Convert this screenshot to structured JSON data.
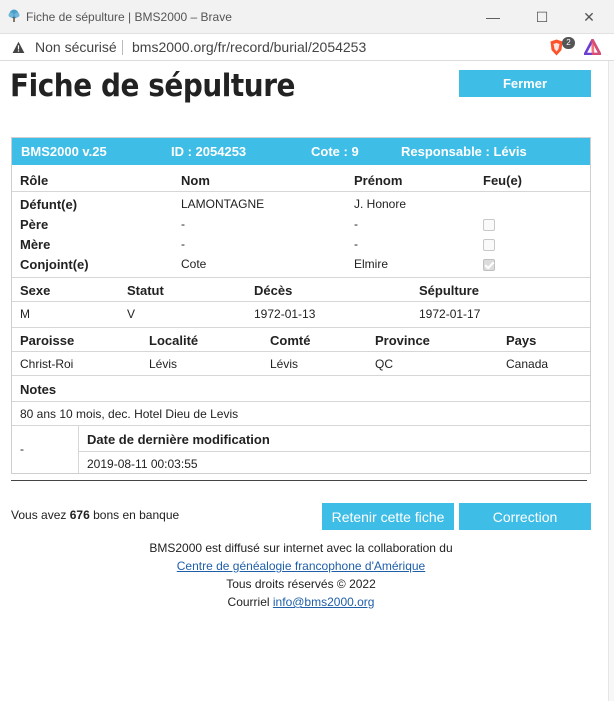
{
  "window": {
    "title": "Fiche de sépulture | BMS2000 – Brave",
    "controls": {
      "minimize": "—",
      "maximize": "☐",
      "close": "✕"
    }
  },
  "addressbar": {
    "security_label": "Non sécurisé",
    "url": "bms2000.org/fr/record/burial/2054253",
    "brave_badge": "2"
  },
  "page": {
    "title": "Fiche de sépulture",
    "close_button": "Fermer"
  },
  "record_header": {
    "version": "BMS2000 v.25",
    "id": "ID : 2054253",
    "cote": "Cote : 9",
    "responsable": "Responsable : Lévis"
  },
  "persons": {
    "headers": {
      "role": "Rôle",
      "nom": "Nom",
      "prenom": "Prénom",
      "feu": "Feu(e)"
    },
    "rows": [
      {
        "role": "Défunt(e)",
        "nom": "LAMONTAGNE",
        "prenom": "J. Honore",
        "feu": null
      },
      {
        "role": "Père",
        "nom": "-",
        "prenom": "-",
        "feu": false
      },
      {
        "role": "Mère",
        "nom": "-",
        "prenom": "-",
        "feu": false
      },
      {
        "role": "Conjoint(e)",
        "nom": "Cote",
        "prenom": "Elmire",
        "feu": true
      }
    ]
  },
  "details": {
    "headers": {
      "sexe": "Sexe",
      "statut": "Statut",
      "deces": "Décès",
      "sepulture": "Sépulture"
    },
    "values": {
      "sexe": "M",
      "statut": "V",
      "deces": "1972-01-13",
      "sepulture": "1972-01-17"
    }
  },
  "location": {
    "headers": {
      "paroisse": "Paroisse",
      "localite": "Localité",
      "comte": "Comté",
      "province": "Province",
      "pays": "Pays"
    },
    "values": {
      "paroisse": "Christ-Roi",
      "localite": "Lévis",
      "comte": "Lévis",
      "province": "QC",
      "pays": "Canada"
    }
  },
  "notes": {
    "header": "Notes",
    "text": "80 ans 10 mois, dec. Hotel Dieu de Levis"
  },
  "modification": {
    "left_value": "-",
    "header": "Date de dernière modification",
    "date": "2019-08-11 00:03:55"
  },
  "bank": {
    "prefix": "Vous avez",
    "count": "676",
    "suffix": "bons en banque"
  },
  "actions": {
    "retain": "Retenir cette fiche",
    "correction": "Correction"
  },
  "footer": {
    "line1": "BMS2000 est diffusé sur internet avec la collaboration du",
    "link": "Centre de généalogie francophone d'Amérique",
    "rights": "Tous droits réservés © 2022",
    "email_prefix": "Courriel",
    "email": "info@bms2000.org"
  },
  "colors": {
    "accent": "#3ebde6",
    "link": "#1f5fa8",
    "brave": "#fb542b"
  }
}
